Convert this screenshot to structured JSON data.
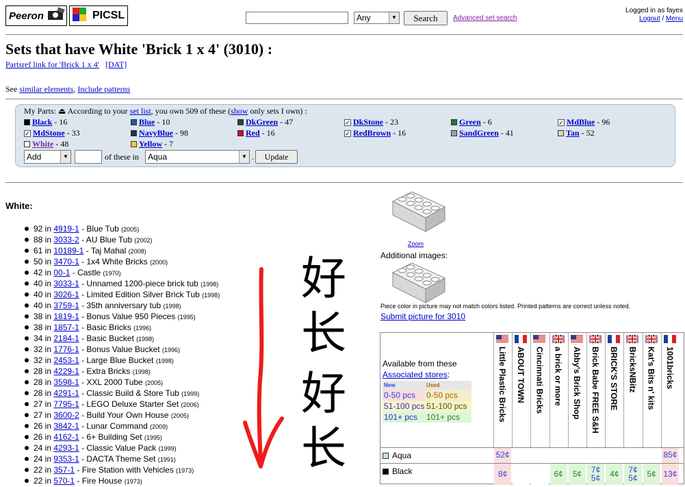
{
  "header": {
    "logo_peeron": "Peeron",
    "logo_picsl": "PICSL",
    "search_value": "",
    "search_scope": "Any",
    "search_button": "Search",
    "advanced_search": "Advanced set search",
    "logged_in": "Logged in as fayex",
    "logout": "Logout",
    "separator": "/",
    "menu": "Menu"
  },
  "page": {
    "title": "Sets that have White 'Brick 1 x 4' (3010) :",
    "partsref_link": "Partsref link for 'Brick 1 x 4'",
    "dat_link": "[DAT]",
    "see_label": "See",
    "similar_link": "similar elements",
    "include_link": "Include patterns"
  },
  "myparts": {
    "intro_a": "My Parts:",
    "intro_b": "According to your",
    "set_list_link": "set list",
    "intro_c": ", you own 509 of these (",
    "show_link": "show",
    "intro_d": "only sets I own) :",
    "colors": [
      {
        "name": "Black",
        "count": "- 16",
        "swatch": "#000000",
        "checkbox": false
      },
      {
        "name": "Blue",
        "count": "- 10",
        "swatch": "#1c5fa8",
        "checkbox": false
      },
      {
        "name": "DkGreen",
        "count": "- 47",
        "swatch": "#1f4d2c",
        "checkbox": false
      },
      {
        "name": "DkStone",
        "count": "- 23",
        "swatch": "",
        "checkbox": true
      },
      {
        "name": "Green",
        "count": "- 6",
        "swatch": "#1e7a33",
        "checkbox": false
      },
      {
        "name": "MdBlue",
        "count": "- 96",
        "swatch": "",
        "checkbox": true
      },
      {
        "name": "MdStone",
        "count": "- 33",
        "swatch": "",
        "checkbox": true
      },
      {
        "name": "NavyBlue",
        "count": "- 98",
        "swatch": "#1d2f52",
        "checkbox": false
      },
      {
        "name": "Red",
        "count": "- 16",
        "swatch": "#c8102e",
        "checkbox": false
      },
      {
        "name": "RedBrown",
        "count": "- 16",
        "swatch": "",
        "checkbox": true
      },
      {
        "name": "SandGreen",
        "count": "- 41",
        "swatch": "#8fa89a",
        "checkbox": false
      },
      {
        "name": "Tan",
        "count": "- 52",
        "swatch": "#e4d6b0",
        "checkbox": false
      },
      {
        "name": "White",
        "count": "- 48",
        "swatch": "#ffffff",
        "checkbox": false
      },
      {
        "name": "Yellow",
        "count": "- 7",
        "swatch": "#f5cd2f",
        "checkbox": false
      }
    ],
    "action_value": "Add",
    "qty_value": "",
    "of_these_in": "of these in",
    "target_color": "Aqua",
    "dot": ".",
    "update_button": "Update"
  },
  "white_heading": "White:",
  "sets": [
    {
      "qty": "92 in",
      "id": "4919-1",
      "name": "- Blue Tub",
      "year": "(2005)"
    },
    {
      "qty": "88 in",
      "id": "3033-2",
      "name": "- AU Blue Tub",
      "year": "(2002)"
    },
    {
      "qty": "61 in",
      "id": "10189-1",
      "name": "- Taj Mahal",
      "year": "(2008)"
    },
    {
      "qty": "50 in",
      "id": "3470-1",
      "name": "- 1x4 White Bricks",
      "year": "(2000)"
    },
    {
      "qty": "42 in",
      "id": "00-1",
      "name": "- Castle",
      "year": "(1970)"
    },
    {
      "qty": "40 in",
      "id": "3033-1",
      "name": "- Unnamed 1200-piece brick tub",
      "year": "(1998)"
    },
    {
      "qty": "40 in",
      "id": "3026-1",
      "name": "- Limited Edition Silver Brick Tub",
      "year": "(1998)"
    },
    {
      "qty": "40 in",
      "id": "3759-1",
      "name": "- 35th anniversary tub",
      "year": "(1998)"
    },
    {
      "qty": "38 in",
      "id": "1819-1",
      "name": "- Bonus Value 950 Pieces",
      "year": "(1995)"
    },
    {
      "qty": "38 in",
      "id": "1857-1",
      "name": "- Basic Bricks",
      "year": "(1996)"
    },
    {
      "qty": "34 in",
      "id": "2184-1",
      "name": "- Basic Bucket",
      "year": "(1998)"
    },
    {
      "qty": "32 in",
      "id": "1776-1",
      "name": "- Bonus Value Bucket",
      "year": "(1996)"
    },
    {
      "qty": "32 in",
      "id": "2453-1",
      "name": "- Large Blue Bucket",
      "year": "(1998)"
    },
    {
      "qty": "28 in",
      "id": "4229-1",
      "name": "- Extra Bricks",
      "year": "(1998)"
    },
    {
      "qty": "28 in",
      "id": "3598-1",
      "name": "- XXL 2000 Tube",
      "year": "(2005)"
    },
    {
      "qty": "28 in",
      "id": "4291-1",
      "name": "- Classic Build & Store Tub",
      "year": "(1999)"
    },
    {
      "qty": "27 in",
      "id": "7795-1",
      "name": "- LEGO Deluxe Starter Set",
      "year": "(2006)"
    },
    {
      "qty": "27 in",
      "id": "3600-2",
      "name": "- Build Your Own House",
      "year": "(2005)"
    },
    {
      "qty": "26 in",
      "id": "3842-1",
      "name": "- Lunar Command",
      "year": "(2009)"
    },
    {
      "qty": "26 in",
      "id": "4162-1",
      "name": "- 6+ Building Set",
      "year": "(1995)"
    },
    {
      "qty": "24 in",
      "id": "4293-1",
      "name": "- Classic Value Pack",
      "year": "(1999)"
    },
    {
      "qty": "24 in",
      "id": "9353-1",
      "name": "- DACTA Theme Set",
      "year": "(1991)"
    },
    {
      "qty": "22 in",
      "id": "357-1",
      "name": "- Fire Station with Vehicles",
      "year": "(1973)"
    },
    {
      "qty": "22 in",
      "id": "570-1",
      "name": "- Fire House",
      "year": "(1973)"
    }
  ],
  "annotation": {
    "chars": [
      "好",
      "长",
      "好",
      "长"
    ],
    "arrow_color": "#ee1c1c"
  },
  "image_panel": {
    "zoom": "Zoom",
    "additional": "Additional images:",
    "note": "Piece color in picture may not match colors listed. Printed patterns are correct unless noted.",
    "submit": "Submit picture for 3010"
  },
  "stores": {
    "available": "Available from these",
    "associated": "Associated stores",
    "colon": ":",
    "legend_new": "New",
    "legend_used": "Used",
    "legend": [
      {
        "new": "0-50 pcs",
        "used": "0-50 pcs",
        "newcolor": "#3344dd",
        "usedcolor": "#aa6600",
        "bg": "#f9dede",
        "ubg": "#f3edc8"
      },
      {
        "new": "51-100 pcs",
        "used": "51-100 pcs",
        "newcolor": "#2233cc",
        "usedcolor": "#555500",
        "bg": "#f7f3c9",
        "ubg": "#f7f3c9"
      },
      {
        "new": "101+ pcs",
        "used": "101+ pcs",
        "newcolor": "#2233cc",
        "usedcolor": "#228822",
        "bg": "#dff5d8",
        "ubg": "#dff5d8"
      }
    ],
    "columns": [
      {
        "name": "Little Plastic Bricks",
        "flag": "us"
      },
      {
        "name": "ABOUT TOWN",
        "flag": "fr"
      },
      {
        "name": "Cincinnati Bricks",
        "flag": "us"
      },
      {
        "name": "a brick or more",
        "flag": "uk"
      },
      {
        "name": "Abby's Brick Shop",
        "flag": "us"
      },
      {
        "name": "Brick Babe FREE S&H",
        "flag": "uk"
      },
      {
        "name": "BRICK'S STORE",
        "flag": "fr"
      },
      {
        "name": "BricksNBitz",
        "flag": "uk"
      },
      {
        "name": "Kat's Bits n' kits",
        "flag": "uk"
      },
      {
        "name": "1001bricks",
        "flag": "fr"
      }
    ],
    "rows": [
      {
        "color": "Aqua",
        "swatch": "#c8e4e4",
        "cells": [
          "52¢",
          "",
          "",
          "",
          "",
          "",
          "",
          "",
          "",
          "85¢"
        ]
      },
      {
        "color": "Black",
        "swatch": "#000000",
        "cells": [
          "8¢",
          "",
          "",
          "6¢",
          "5¢",
          "7¢ 5¢",
          "4¢",
          "7¢ 5¢",
          "5¢",
          "13¢"
        ]
      }
    ]
  }
}
